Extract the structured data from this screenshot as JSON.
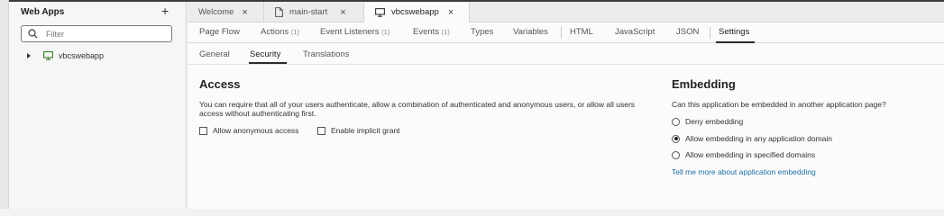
{
  "sidebar": {
    "title": "Web Apps",
    "add_icon": "plus-icon",
    "filter_placeholder": "Filter",
    "tree": [
      {
        "label": "vbcswebapp",
        "icon": "monitor-icon"
      }
    ]
  },
  "tabs": [
    {
      "label": "Welcome",
      "icon": "",
      "active": false
    },
    {
      "label": "main-start",
      "icon": "page-icon",
      "active": false
    },
    {
      "label": "vbcswebapp",
      "icon": "monitor-icon",
      "active": true
    }
  ],
  "subnav": {
    "items": [
      {
        "label": "Page Flow",
        "count": ""
      },
      {
        "label": "Actions",
        "count": "(1)"
      },
      {
        "label": "Event Listeners",
        "count": "(1)"
      },
      {
        "label": "Events",
        "count": "(1)"
      },
      {
        "label": "Types",
        "count": ""
      },
      {
        "label": "Variables",
        "count": ""
      },
      {
        "label": "HTML",
        "count": ""
      },
      {
        "label": "JavaScript",
        "count": ""
      },
      {
        "label": "JSON",
        "count": ""
      },
      {
        "label": "Settings",
        "count": ""
      }
    ],
    "active": "Settings"
  },
  "settings_tabs": {
    "items": [
      "General",
      "Security",
      "Translations"
    ],
    "active": "Security"
  },
  "access": {
    "heading": "Access",
    "description": "You can require that all of your users authenticate, allow a combination of authenticated and anonymous users, or allow all users access without authenticating first.",
    "options": [
      {
        "label": "Allow anonymous access",
        "checked": false
      },
      {
        "label": "Enable implicit grant",
        "checked": false
      }
    ]
  },
  "embedding": {
    "heading": "Embedding",
    "question": "Can this application be embedded in another application page?",
    "options": [
      {
        "label": "Deny embedding",
        "selected": false
      },
      {
        "label": "Allow embedding in any application domain",
        "selected": true
      },
      {
        "label": "Allow embedding in specified domains",
        "selected": false
      }
    ],
    "help_link": "Tell me more about application embedding"
  },
  "colors": {
    "accent_green": "#3c7a2e",
    "link_blue": "#1d6fa5"
  }
}
